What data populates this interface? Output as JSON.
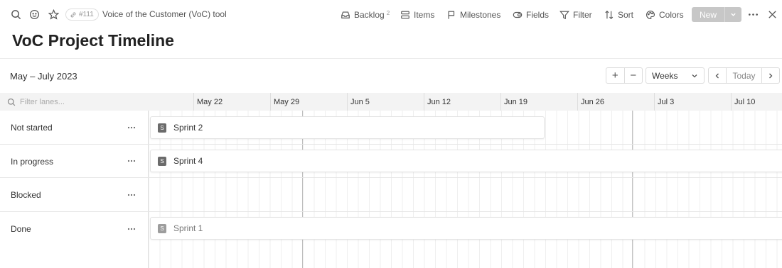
{
  "toolbar": {
    "item_id": "#111",
    "doc_title": "Voice of the Customer (VoC) tool",
    "backlog_label": "Backlog",
    "backlog_count": "2",
    "items_label": "Items",
    "milestones_label": "Milestones",
    "fields_label": "Fields",
    "filter_label": "Filter",
    "sort_label": "Sort",
    "colors_label": "Colors",
    "new_label": "New"
  },
  "page": {
    "title": "VoC Project Timeline"
  },
  "timeline": {
    "range_label": "May – July 2023",
    "zoom_in": "+",
    "zoom_out": "−",
    "scale": "Weeks",
    "today_label": "Today",
    "filter_placeholder": "Filter lanes...",
    "weeks": [
      "May 22",
      "May 29",
      "Jun 5",
      "Jun 12",
      "Jun 19",
      "Jun 26",
      "Jul 3",
      "Jul 10"
    ]
  },
  "lanes": [
    {
      "label": "Not started",
      "items": [
        {
          "badge": "S",
          "label": "Sprint 2",
          "status": "active"
        }
      ]
    },
    {
      "label": "In progress",
      "items": [
        {
          "badge": "S",
          "label": "Sprint 4",
          "status": "active"
        }
      ]
    },
    {
      "label": "Blocked",
      "items": []
    },
    {
      "label": "Done",
      "items": [
        {
          "badge": "S",
          "label": "Sprint 1",
          "status": "done"
        }
      ]
    }
  ],
  "colors": {
    "new_button": "#c7c7c7",
    "header_bg": "#f3f3f3",
    "badge": "#6b6b6b"
  }
}
